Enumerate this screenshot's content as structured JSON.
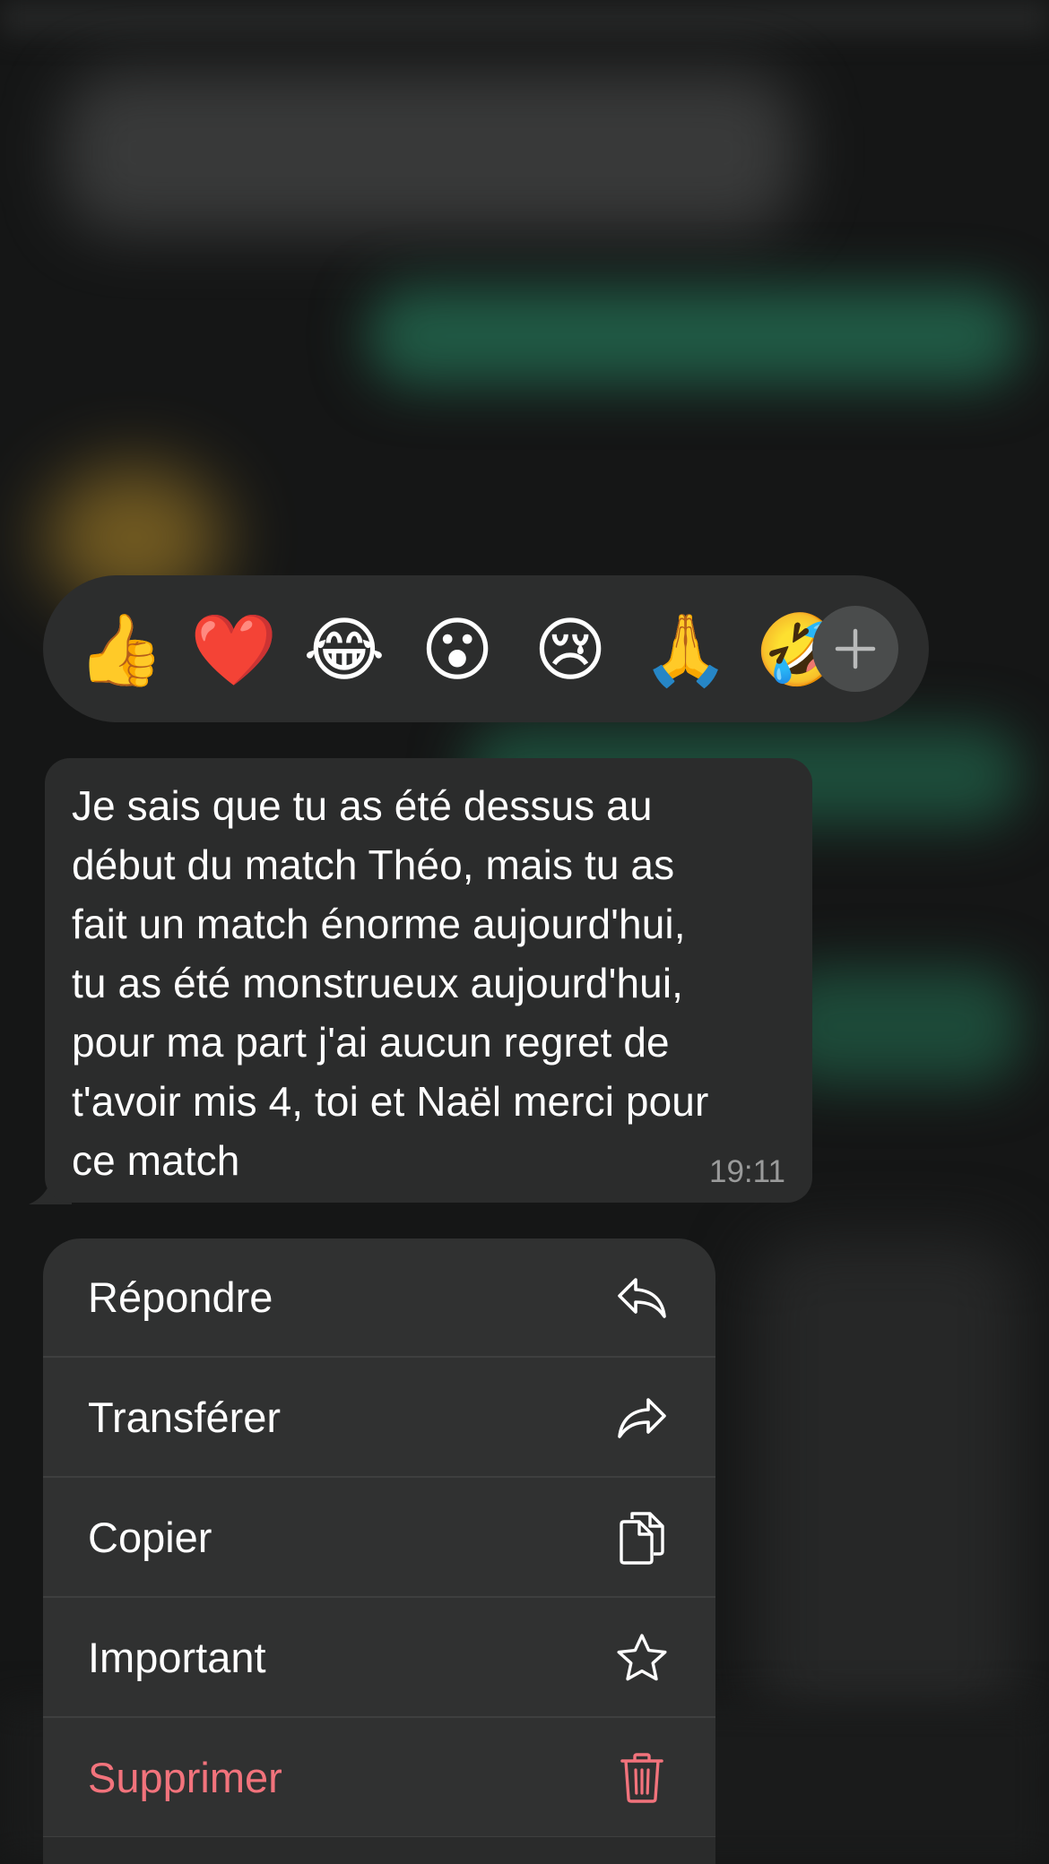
{
  "reactions": {
    "emojis": [
      "👍",
      "❤️",
      "😂",
      "😮",
      "😢",
      "🙏",
      "🤣"
    ],
    "more_icon": "plus-icon"
  },
  "message": {
    "text": "Je sais que tu as été dessus au\ndébut du match Théo, mais tu as\nfait un match énorme aujourd'hui,\ntu as été monstrueux aujourd'hui,\npour ma part j'ai aucun regret de\nt'avoir mis 4, toi et Naël merci pour\nce match",
    "time": "19:11"
  },
  "menu": {
    "items": [
      {
        "label": "Répondre",
        "icon": "reply-icon"
      },
      {
        "label": "Transférer",
        "icon": "forward-icon"
      },
      {
        "label": "Copier",
        "icon": "copy-icon"
      },
      {
        "label": "Important",
        "icon": "star-icon"
      },
      {
        "label": "Supprimer",
        "icon": "trash-icon"
      }
    ]
  },
  "colors": {
    "background": "#151616",
    "bubble": "#2b2c2c",
    "menu": "#303131",
    "danger": "#f2737c"
  }
}
